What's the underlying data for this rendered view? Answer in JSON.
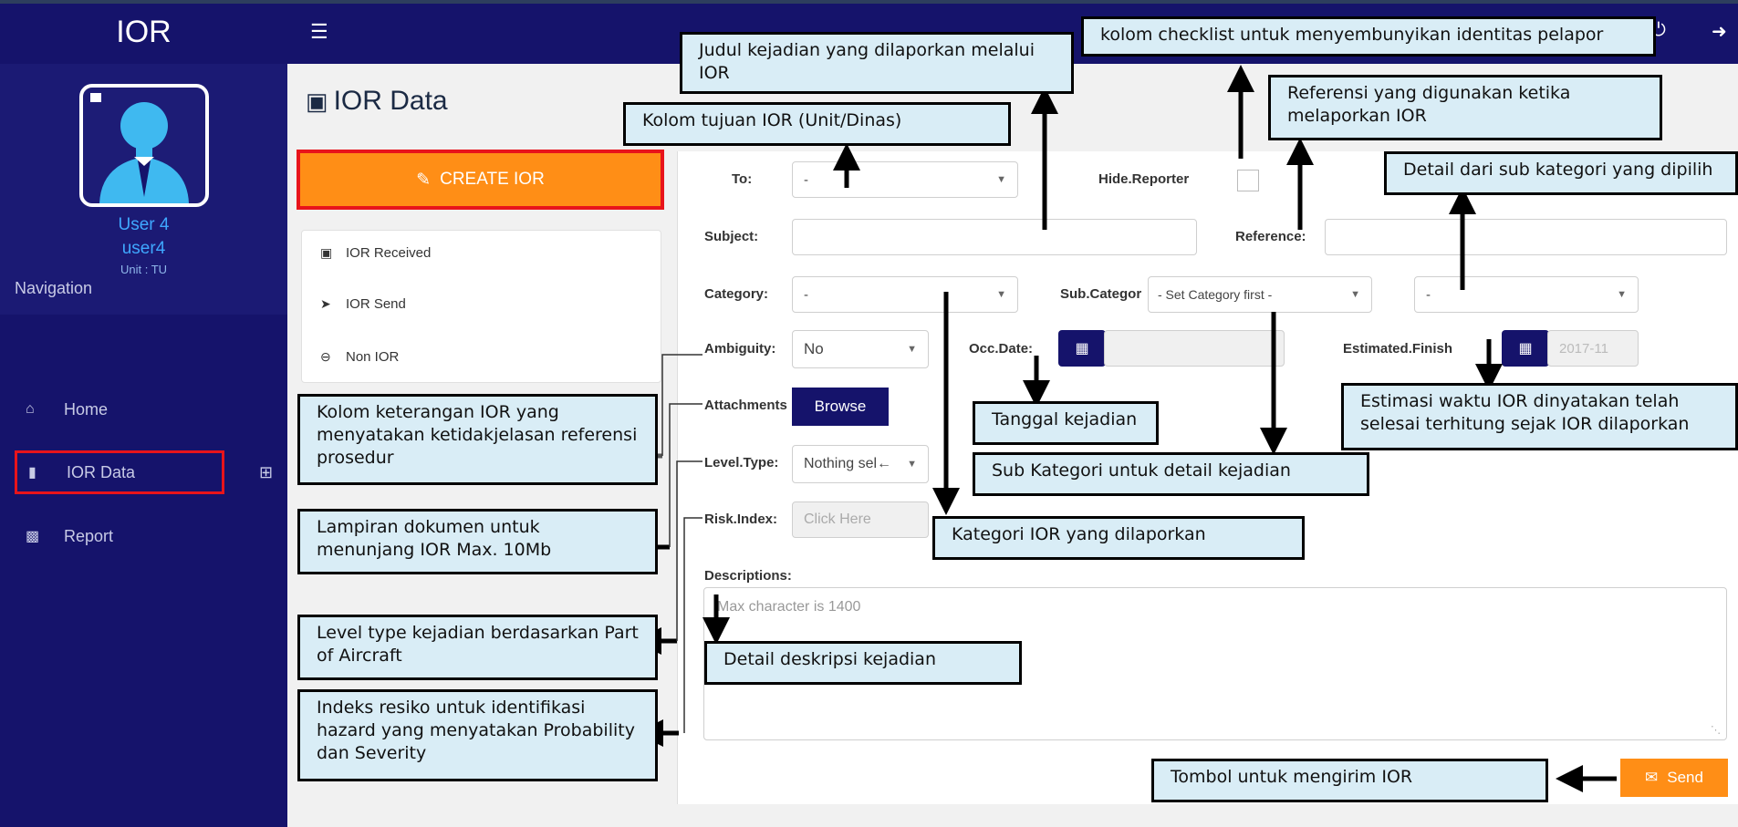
{
  "app": {
    "title": "IOR"
  },
  "user": {
    "display_name": "User 4",
    "username": "user4",
    "unit": "Unit : TU"
  },
  "navigation": {
    "heading": "Navigation",
    "items": [
      {
        "label": "Home",
        "icon": "home-icon"
      },
      {
        "label": "IOR Data",
        "icon": "document-icon"
      },
      {
        "label": "Report",
        "icon": "bar-chart-icon"
      }
    ]
  },
  "page": {
    "title": "IOR Data"
  },
  "create_button": {
    "label": "CREATE IOR"
  },
  "menu": {
    "items": [
      {
        "label": "IOR Received",
        "icon": "inbox-icon"
      },
      {
        "label": "IOR Send",
        "icon": "rocket-icon"
      },
      {
        "label": "Non IOR",
        "icon": "minus-circle-icon"
      }
    ]
  },
  "form": {
    "to": {
      "label": "To:",
      "value": "-"
    },
    "hide_reporter": {
      "label": "Hide.Reporter"
    },
    "subject": {
      "label": "Subject:",
      "value": ""
    },
    "reference": {
      "label": "Reference:",
      "value": ""
    },
    "category": {
      "label": "Category:",
      "value": "-"
    },
    "sub_category": {
      "label": "Sub.Categor",
      "value": "- Set Category first -"
    },
    "sub_category_detail": {
      "value": "-"
    },
    "ambiguity": {
      "label": "Ambiguity:",
      "value": "No"
    },
    "occ_date": {
      "label": "Occ.Date:",
      "value": ""
    },
    "estimated_finish": {
      "label": "Estimated.Finish",
      "value": "2017-11"
    },
    "attachments": {
      "label": "Attachments",
      "button": "Browse"
    },
    "level_type": {
      "label": "Level.Type:",
      "value": "Nothing sel←"
    },
    "risk_index": {
      "label": "Risk.Index:",
      "placeholder": "Click Here"
    },
    "descriptions": {
      "label": "Descriptions:",
      "placeholder": "Max character is 1400"
    },
    "send_button": {
      "label": "Send"
    }
  },
  "callouts": {
    "judul": "Judul kejadian yang dilaporkan melalui IOR",
    "checklist": "kolom checklist untuk menyembunyikan identitas pelapor",
    "referensi": "Referensi yang digunakan ketika melaporkan IOR",
    "tujuan": "Kolom tujuan IOR (Unit/Dinas)",
    "detail_sub": "Detail dari sub kategori yang dipilih",
    "ambiguity": "Kolom keterangan IOR yang menyatakan ketidakjelasan referensi prosedur",
    "lampiran": "Lampiran dokumen untuk menunjang IOR Max. 10Mb",
    "level": "Level type kejadian berdasarkan Part of Aircraft",
    "risk": "Indeks resiko untuk identifikasi hazard yang menyatakan Probability dan Severity",
    "tanggal": "Tanggal kejadian",
    "subkategori": "Sub Kategori untuk detail kejadian",
    "kategori": "Kategori IOR yang dilaporkan",
    "estimasi": "Estimasi waktu IOR dinyatakan telah selesai terhitung sejak IOR dilaporkan",
    "deskripsi": "Detail deskripsi kejadian",
    "tombol": "Tombol untuk mengirim IOR"
  },
  "colors": {
    "navy": "#15136b",
    "orange": "#ff8e16",
    "highlight_red": "#e8141b",
    "callout_bg": "#d9edf6"
  }
}
